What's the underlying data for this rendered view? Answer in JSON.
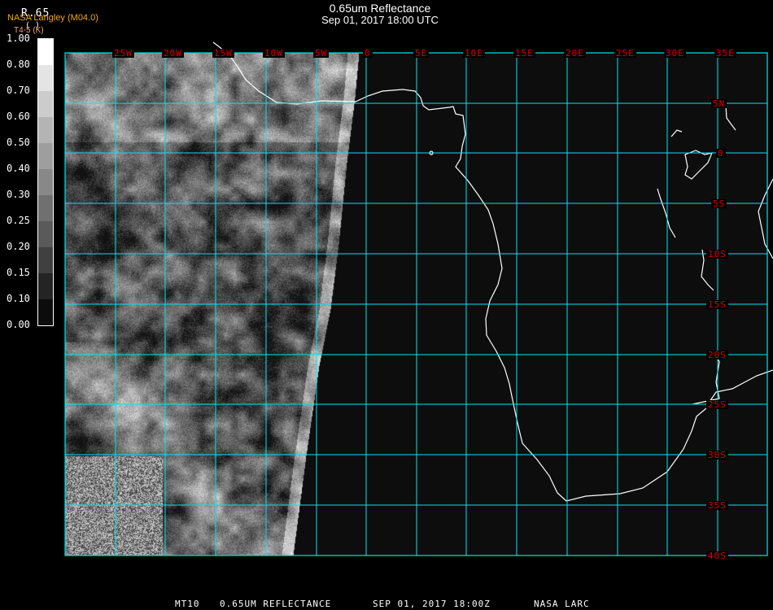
{
  "header": {
    "title": "0.65um Reflectance",
    "subtitle": "Sep 01, 2017 18:00 UTC",
    "provider": "NASA Langley (M04.0)"
  },
  "legend": {
    "variable": "R.65",
    "units": "(  )",
    "sub": "T4-5 (K)",
    "labels": [
      "1.00",
      "0.80",
      "0.70",
      "0.60",
      "0.50",
      "0.40",
      "0.30",
      "0.25",
      "0.20",
      "0.15",
      "0.10",
      "0.00"
    ],
    "colors": [
      "#ffffff",
      "#e4e4e4",
      "#cccccc",
      "#b4b4b4",
      "#9e9e9e",
      "#888888",
      "#707070",
      "#5a5a5a",
      "#404040",
      "#242424",
      "#0c0c0c"
    ]
  },
  "map": {
    "lon_labels": [
      "25W",
      "20W",
      "15W",
      "10W",
      "5W",
      "0",
      "5E",
      "10E",
      "15E",
      "20E",
      "25E",
      "30E",
      "35E"
    ],
    "lat_labels": [
      "5N",
      "0",
      "5S",
      "10S",
      "15S",
      "20S",
      "25S",
      "30S",
      "35S",
      "40S"
    ],
    "grid_color": "#00e5ee",
    "label_color": "#e00000",
    "ocean_color": "#0d0d0d"
  },
  "footer": {
    "product": "MT10",
    "channel": "0.65UM REFLECTANCE",
    "datetime": "SEP 01, 2017 18:00Z",
    "source": "NASA LARC"
  }
}
